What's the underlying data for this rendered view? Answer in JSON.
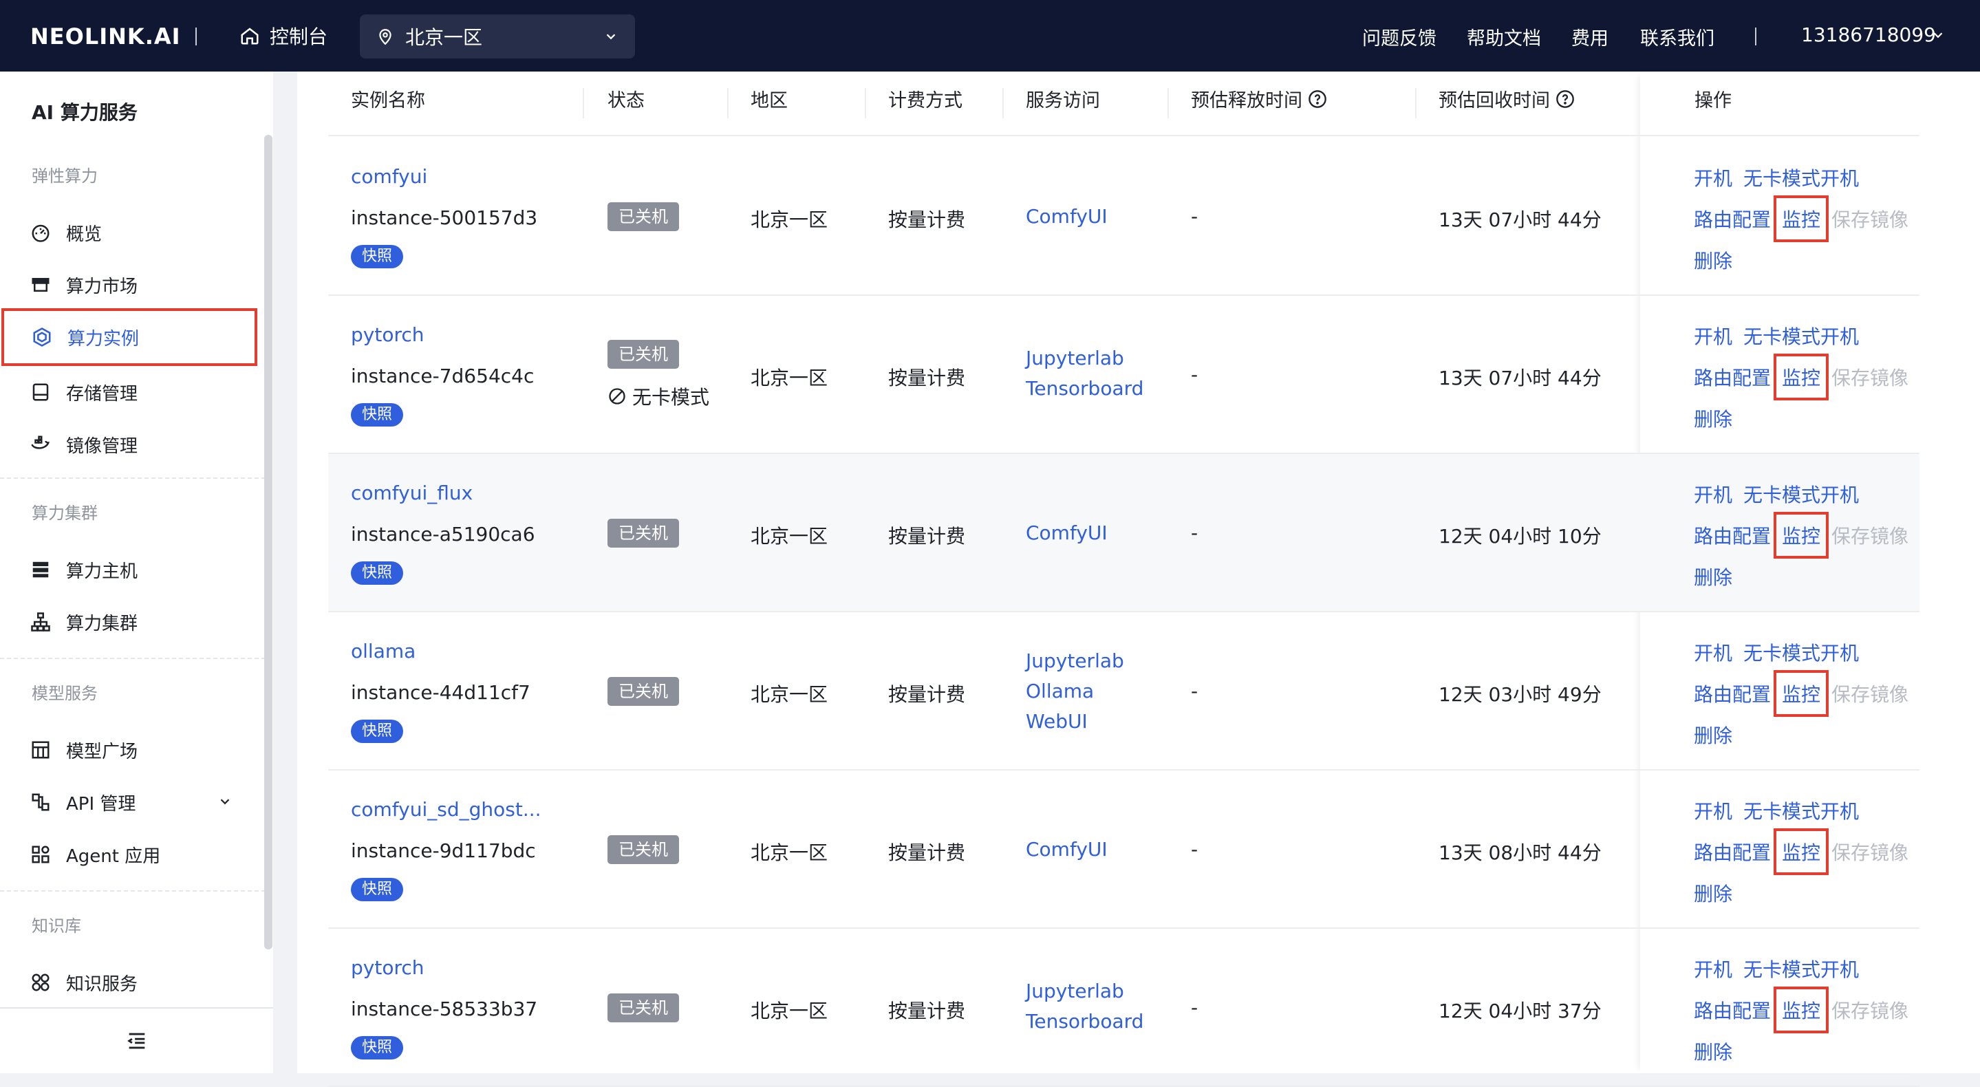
{
  "header": {
    "logo": "NEOLINK.AI",
    "console": "控制台",
    "region": "北京一区",
    "nav": [
      "问题反馈",
      "帮助文档",
      "费用",
      "联系我们"
    ],
    "user": "13186718099"
  },
  "sidebar": {
    "title": "AI 算力服务",
    "groups": {
      "elastic": "弹性算力",
      "cluster": "算力集群",
      "model": "模型服务",
      "kb": "知识库"
    },
    "items": {
      "overview": "概览",
      "market": "算力市场",
      "instances": "算力实例",
      "storage": "存储管理",
      "images": "镜像管理",
      "hosts": "算力主机",
      "clusters": "算力集群",
      "plaza": "模型广场",
      "api": "API 管理",
      "agent": "Agent 应用",
      "kbservice": "知识服务"
    },
    "active": "算力实例"
  },
  "table": {
    "headers": {
      "name": "实例名称",
      "status": "状态",
      "region": "地区",
      "billing": "计费方式",
      "service": "服务访问",
      "release": "预估释放时间",
      "reclaim": "预估回收时间",
      "ops": "操作"
    },
    "badges": {
      "snapshot": "快照",
      "off": "已关机",
      "nocard": "无卡模式"
    },
    "ops": {
      "start": "开机",
      "start_nocard": "无卡模式开机",
      "route": "路由配置",
      "monitor": "监控",
      "save_image": "保存镜像",
      "delete": "删除"
    },
    "rows": [
      {
        "name": "comfyui",
        "id": "instance-500157d3",
        "region": "北京一区",
        "billing": "按量计费",
        "services": [
          "ComfyUI"
        ],
        "release": "-",
        "reclaim": "13天 07小时 44分"
      },
      {
        "name": "pytorch",
        "id": "instance-7d654c4c",
        "region": "北京一区",
        "billing": "按量计费",
        "services": [
          "Jupyterlab",
          "Tensorboard"
        ],
        "release": "-",
        "reclaim": "13天 07小时 44分"
      },
      {
        "name": "comfyui_flux",
        "id": "instance-a5190ca6",
        "region": "北京一区",
        "billing": "按量计费",
        "services": [
          "ComfyUI"
        ],
        "release": "-",
        "reclaim": "12天 04小时 10分"
      },
      {
        "name": "ollama",
        "id": "instance-44d11cf7",
        "region": "北京一区",
        "billing": "按量计费",
        "services": [
          "Jupyterlab",
          "Ollama",
          "WebUI"
        ],
        "release": "-",
        "reclaim": "12天 03小时 49分"
      },
      {
        "name": "comfyui_sd_ghost...",
        "id": "instance-9d117bdc",
        "region": "北京一区",
        "billing": "按量计费",
        "services": [
          "ComfyUI"
        ],
        "release": "-",
        "reclaim": "13天 08小时 44分"
      },
      {
        "name": "pytorch",
        "id": "instance-58533b37",
        "region": "北京一区",
        "billing": "按量计费",
        "services": [
          "Jupyterlab",
          "Tensorboard"
        ],
        "release": "-",
        "reclaim": "12天 04小时 37分"
      }
    ]
  },
  "colors": {
    "topbar": "#0f1733",
    "accent": "#2f5fdc",
    "highlight_box": "#e23d2d",
    "badge_off": "#8a8f99",
    "disabled": "#b7bbc4"
  }
}
